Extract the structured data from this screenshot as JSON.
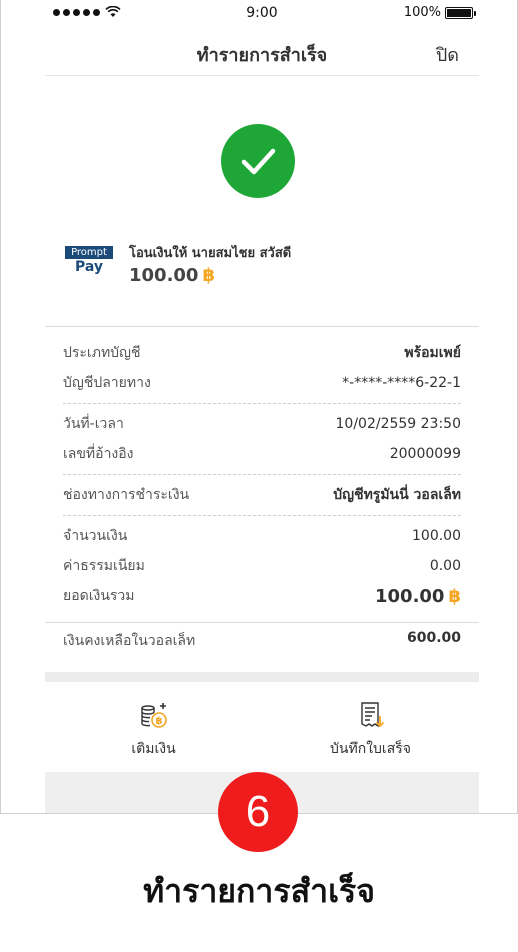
{
  "status_bar": {
    "time": "9:00",
    "battery": "100%"
  },
  "header": {
    "title": "ทำรายการสำเร็จ",
    "close_label": "ปิด"
  },
  "transfer": {
    "logo_top": "Prompt",
    "logo_bottom": "Pay",
    "recipient": "โอนเงินให้ นายสมไชย สวัสดี",
    "amount": "100.00",
    "currency_symbol": "฿"
  },
  "details": {
    "account_type": {
      "label": "ประเภทบัญชี",
      "value": "พร้อมเพย์"
    },
    "destination_account": {
      "label": "บัญชีปลายทาง",
      "value": "*-****-****6-22-1"
    },
    "datetime": {
      "label": "วันที่-เวลา",
      "value": "10/02/2559 23:50"
    },
    "reference": {
      "label": "เลขที่อ้างอิง",
      "value": "20000099"
    },
    "payment_channel": {
      "label": "ช่องทางการชำระเงิน",
      "value": "บัญชีทรูมันนี่ วอลเล็ท"
    },
    "amount": {
      "label": "จำนวนเงิน",
      "value": "100.00"
    },
    "fee": {
      "label": "ค่าธรรมเนียม",
      "value": "0.00"
    },
    "total": {
      "label": "ยอดเงินรวม",
      "value": "100.00"
    }
  },
  "balance": {
    "label": "เงินคงเหลือในวอลเล็ท",
    "value": "600.00"
  },
  "actions": {
    "topup_label": "เติมเงิน",
    "save_receipt_label": "บันทึกใบเสร็จ"
  },
  "step": {
    "number": "6",
    "caption": "ทำรายการสำเร็จ"
  },
  "colors": {
    "success": "#1ea737",
    "baht": "#f5a623",
    "step_badge": "#ee1c1c",
    "promptpay": "#1c4b7a"
  }
}
